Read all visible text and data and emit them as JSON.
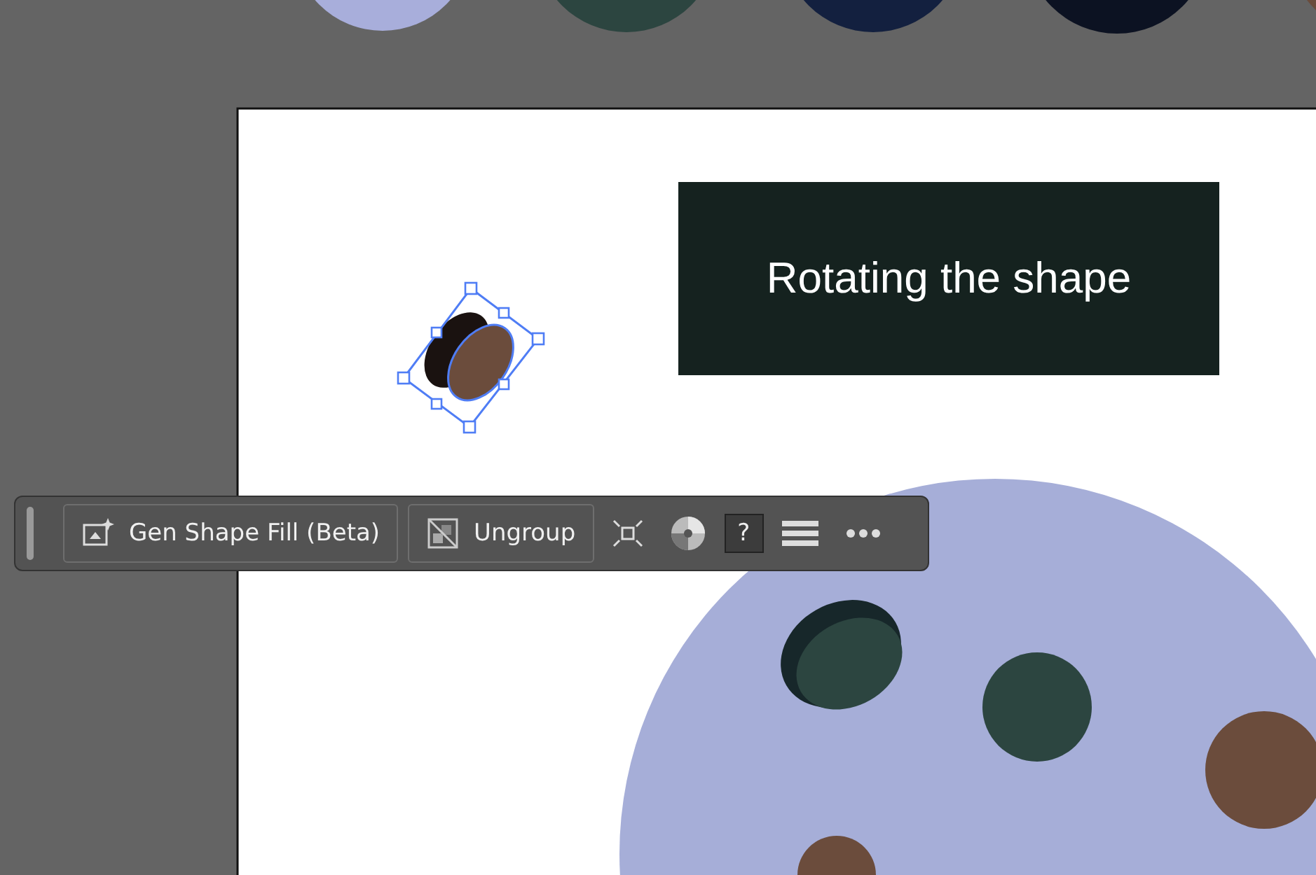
{
  "caption": {
    "text": "Rotating the shape"
  },
  "toolbar": {
    "buttons": [
      {
        "kind": "gen-fill",
        "label": "Gen Shape Fill (Beta)"
      },
      {
        "kind": "ungroup",
        "label": "Ungroup"
      }
    ],
    "icons": [
      {
        "kind": "fit"
      },
      {
        "kind": "recolor"
      },
      {
        "kind": "help",
        "label": "?"
      },
      {
        "kind": "menu"
      },
      {
        "kind": "more"
      }
    ]
  }
}
